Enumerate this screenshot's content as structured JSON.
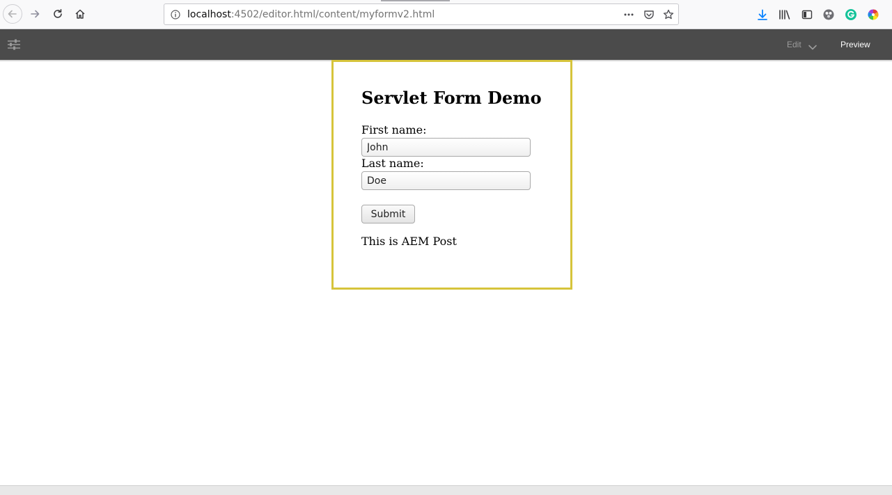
{
  "browser": {
    "url_host": "localhost",
    "url_path": ":4502/editor.html/content/myformv2.html",
    "icons": {
      "back": "arrow-left-icon",
      "forward": "arrow-right-icon",
      "reload": "reload-icon",
      "home": "home-icon",
      "site_info": "info-icon",
      "page_actions": "more-horizontal-icon",
      "pocket": "pocket-icon",
      "bookmark": "star-icon",
      "downloads": "download-icon",
      "library": "library-icon",
      "sidebar": "sidebar-icon",
      "extension": "extension-icon",
      "grammarly": "grammarly-icon",
      "color_ext": "color-wheel-icon"
    }
  },
  "editor": {
    "mode_label": "Edit",
    "preview_label": "Preview",
    "icons": {
      "panel_toggle": "sliders-icon",
      "mode_dropdown": "chevron-down-icon"
    }
  },
  "form": {
    "title": "Servlet Form Demo",
    "first_name_label": "First name:",
    "first_name_value": "John",
    "last_name_label": "Last name:",
    "last_name_value": "Doe",
    "submit_label": "Submit",
    "result_text": "This is AEM Post"
  },
  "colors": {
    "component_border": "#d6c43b",
    "editor_bar": "#4b4b4b",
    "download_icon": "#0a84ff",
    "grammarly": "#15c39a"
  }
}
